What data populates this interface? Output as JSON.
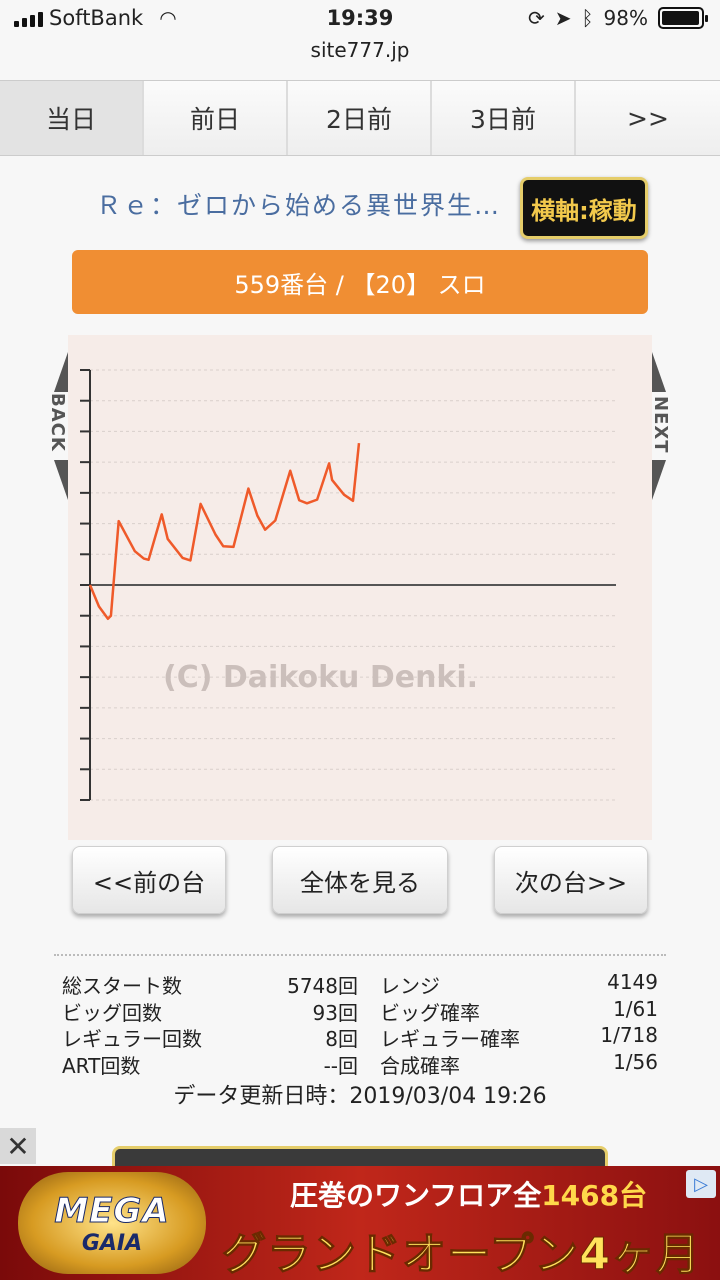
{
  "status_bar": {
    "carrier": "SoftBank",
    "time": "19:39",
    "battery": "98%",
    "battery_level": 0.98,
    "url": "site777.jp"
  },
  "tabs": [
    {
      "label": "当日",
      "active": true
    },
    {
      "label": "前日",
      "active": false
    },
    {
      "label": "2日前",
      "active": false
    },
    {
      "label": "3日前",
      "active": false
    },
    {
      "label": ">>",
      "active": false
    }
  ],
  "machine": {
    "title": "Ｒｅ：ゼロから始める異世界生…",
    "axis_button": "横軸:稼動",
    "banner": "559番台 / 【20】 スロ"
  },
  "chart": {
    "back_label": "BACK",
    "next_label": "NEXT",
    "watermark": "(C) Daikoku Denki."
  },
  "chart_data": {
    "type": "line",
    "x": [
      0,
      1.5,
      3,
      3.5,
      4.8,
      7.5,
      9,
      9.8,
      12,
      13,
      15.5,
      16.8,
      18.5,
      21,
      22.3,
      24,
      26.5,
      28,
      29.3,
      31,
      33.5,
      35,
      36.3,
      38,
      40,
      40.5,
      42.5,
      44,
      45
    ],
    "y": [
      0,
      -350,
      -550,
      -500,
      1040,
      550,
      430,
      410,
      1150,
      750,
      440,
      400,
      1320,
      820,
      630,
      620,
      1570,
      1130,
      900,
      1050,
      1860,
      1380,
      1330,
      1390,
      1980,
      1710,
      1470,
      1370,
      2310
    ],
    "ylim": [
      -3500,
      3500
    ],
    "grid": true,
    "color": "#ef5a2a"
  },
  "buttons": {
    "prev": "<<前の台",
    "all": "全体を見る",
    "next": "次の台>>"
  },
  "stats": [
    {
      "label1": "総スタート数",
      "value1": "5748回",
      "label2": "レンジ",
      "value2": "4149"
    },
    {
      "label1": "ビッグ回数",
      "value1": "93回",
      "label2": "ビッグ確率",
      "value2": "1/61"
    },
    {
      "label1": "レギュラー回数",
      "value1": "8回",
      "label2": "レギュラー確率",
      "value2": "1/718"
    },
    {
      "label1": "ART回数",
      "value1": "--回",
      "label2": "合成確率",
      "value2": "1/56"
    }
  ],
  "updated": "データ更新日時：2019/03/04 19:26",
  "ad": {
    "close": "✕",
    "logo_top": "MEGA",
    "logo_bottom": "GAIA",
    "line1_a": "圧巻の",
    "line1_b": "ワンフロア全",
    "line1_c": "1468台",
    "line2": "グランドオープン4ヶ月",
    "info": "▷"
  }
}
